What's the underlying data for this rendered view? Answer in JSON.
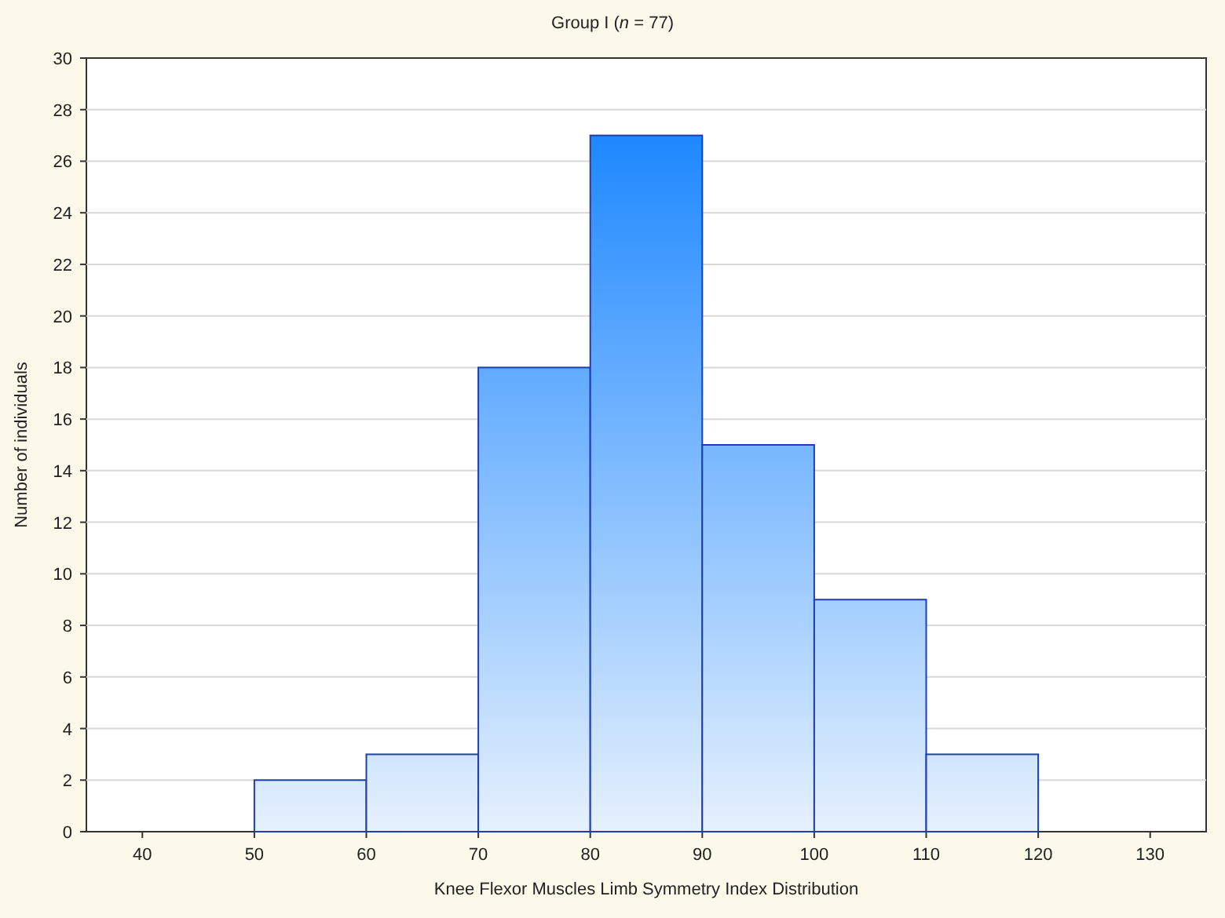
{
  "chart_data": {
    "type": "bar",
    "title": "Group I (*n* = 77)",
    "xlabel": "Knee Flexor Muscles Limb Symmetry Index Distribution",
    "ylabel": "Number of individuals",
    "x": [
      55,
      65,
      75,
      85,
      95,
      105,
      115
    ],
    "series": [
      {
        "color": "#1f3fb0",
        "values": [
          2,
          3,
          18,
          27,
          15,
          9,
          3
        ]
      }
    ],
    "grid": true,
    "xlim": [
      35,
      135
    ],
    "ylim": [
      0,
      30
    ],
    "xticks": [
      40,
      50,
      60,
      70,
      80,
      90,
      100,
      110,
      120,
      130
    ],
    "yticks": [
      0,
      2,
      4,
      6,
      8,
      10,
      12,
      14,
      16,
      18,
      20,
      22,
      24,
      26,
      28,
      30
    ]
  }
}
